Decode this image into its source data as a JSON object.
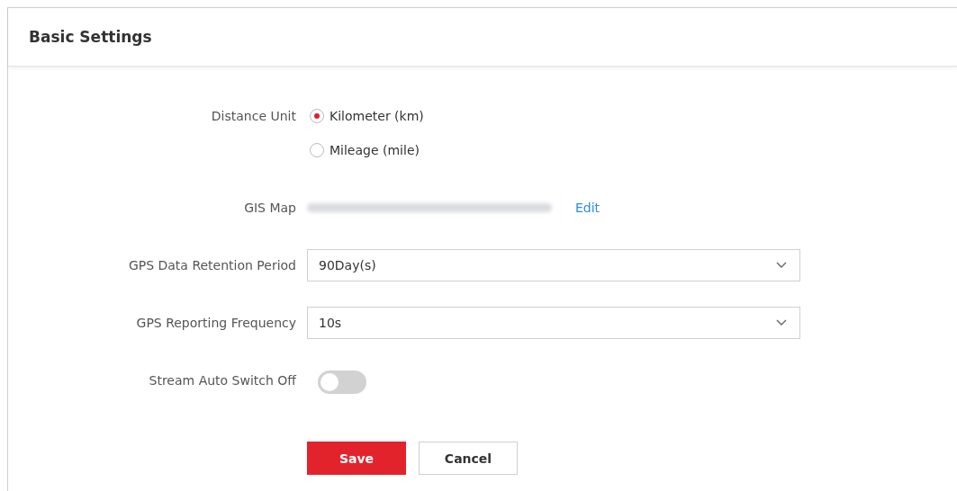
{
  "title": "Basic Settings",
  "fields": [
    {
      "kind": "radio",
      "label": "Distance Unit",
      "options": [
        {
          "label": "Kilometer (km)",
          "selected": true
        },
        {
          "label": "Mileage (mile)",
          "selected": false
        }
      ]
    },
    {
      "kind": "map",
      "label": "GIS Map",
      "link": "Edit"
    },
    {
      "kind": "select",
      "label": "GPS Data Retention Period",
      "value": "90Day(s)"
    },
    {
      "kind": "select",
      "label": "GPS Reporting Frequency",
      "value": "10s"
    },
    {
      "kind": "toggle",
      "label": "Stream Auto Switch Off",
      "on": false
    }
  ],
  "buttons": [
    {
      "kind": "primary",
      "label": "Save"
    },
    {
      "kind": "secondary",
      "label": "Cancel"
    }
  ]
}
